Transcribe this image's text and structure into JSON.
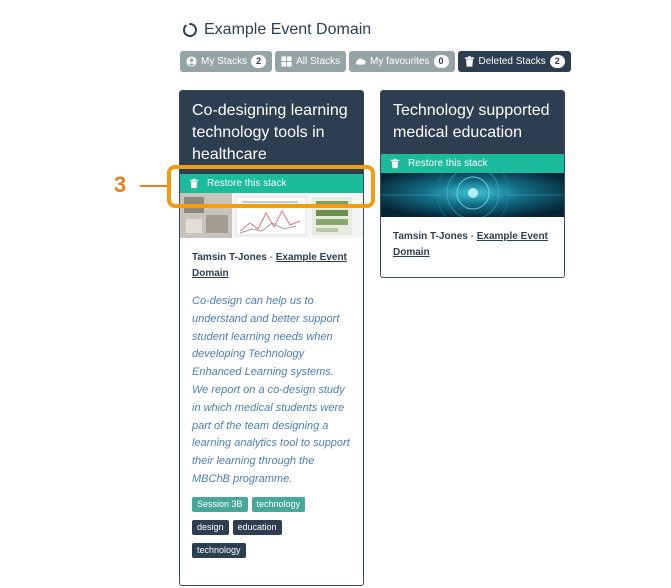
{
  "domain": {
    "title": "Example Event Domain",
    "icon": "loading-ring-icon"
  },
  "tabs": [
    {
      "label": "My Stacks",
      "icon": "user-icon",
      "count": "2",
      "active": false
    },
    {
      "label": "All Stacks",
      "icon": "grid-icon",
      "active": false
    },
    {
      "label": "My favourites",
      "icon": "cloud-icon",
      "count": "0",
      "active": false
    },
    {
      "label": "Deleted Stacks",
      "icon": "trash-icon",
      "count": "2",
      "active": true
    }
  ],
  "stacks": [
    {
      "title": "Co-designing learning technology tools in healthcare",
      "restore_label": "Restore this stack",
      "author": "Tamsin T-Jones",
      "separator": " - ",
      "domain_link": "Example Event Domain",
      "description": "Co-design can help us to understand and better support student learning needs when developing Technology Enhanced Learning systems. We report on a co-design study in which medical students were part of the team designing a learning analytics tool to support their learning through the MBChB programme.",
      "tags": [
        {
          "label": "Session 3B",
          "color": "teal"
        },
        {
          "label": "technology",
          "color": "teal"
        },
        {
          "label": "design",
          "color": "navy"
        },
        {
          "label": "education",
          "color": "navy"
        },
        {
          "label": "technology",
          "color": "navy"
        }
      ]
    },
    {
      "title": "Technology supported medical education",
      "restore_label": "Restore this stack",
      "author": "Tamsin T-Jones",
      "separator": " - ",
      "domain_link": "Example Event Domain"
    }
  ],
  "annotation": {
    "number": "3"
  },
  "colors": {
    "header": "#2c3e50",
    "restore": "#1abc9c",
    "tab": "#95a5a6",
    "highlight": "#f39c12",
    "callout": "#e67e22"
  }
}
